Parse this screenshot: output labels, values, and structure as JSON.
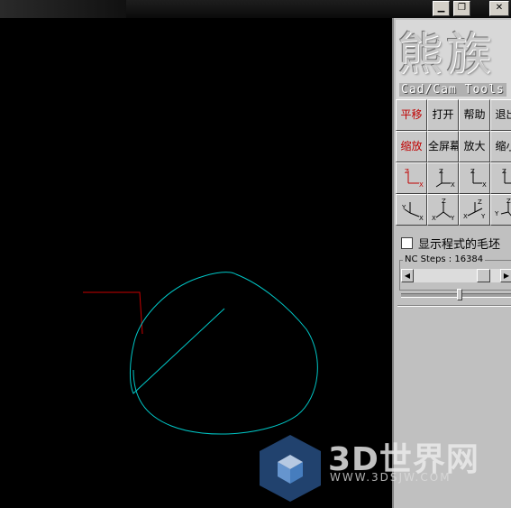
{
  "window": {
    "minimize_glyph": "▁",
    "restore_glyph": "❐",
    "close_glyph": "✕"
  },
  "panel": {
    "logo_cn": "熊族",
    "logo_en": "Cad/Cam Tools",
    "buttons_row1": [
      "平移",
      "打开",
      "帮助",
      "退出"
    ],
    "buttons_row2": [
      "缩放",
      "全屏幕",
      "放大",
      "缩小"
    ],
    "view_icons": [
      "view-xz-icon",
      "view-zx-icon",
      "view-xz-alt-icon",
      "view-yz-icon",
      "view-iso-xy-icon",
      "view-iso-xyz-icon",
      "view-iso-yxz-icon",
      "view-iso-yz-icon"
    ],
    "checkbox_label": "显示程式的毛坯",
    "nc_steps_label": "NC Steps : 16384",
    "accent_red": "#c00000"
  },
  "canvas": {
    "toolpath_color": "#00c8c8",
    "rapid_color": "#c80000",
    "background": "#000000"
  },
  "watermark": {
    "brand": "3D世界网",
    "url": "WWW.3DSJW.COM"
  }
}
